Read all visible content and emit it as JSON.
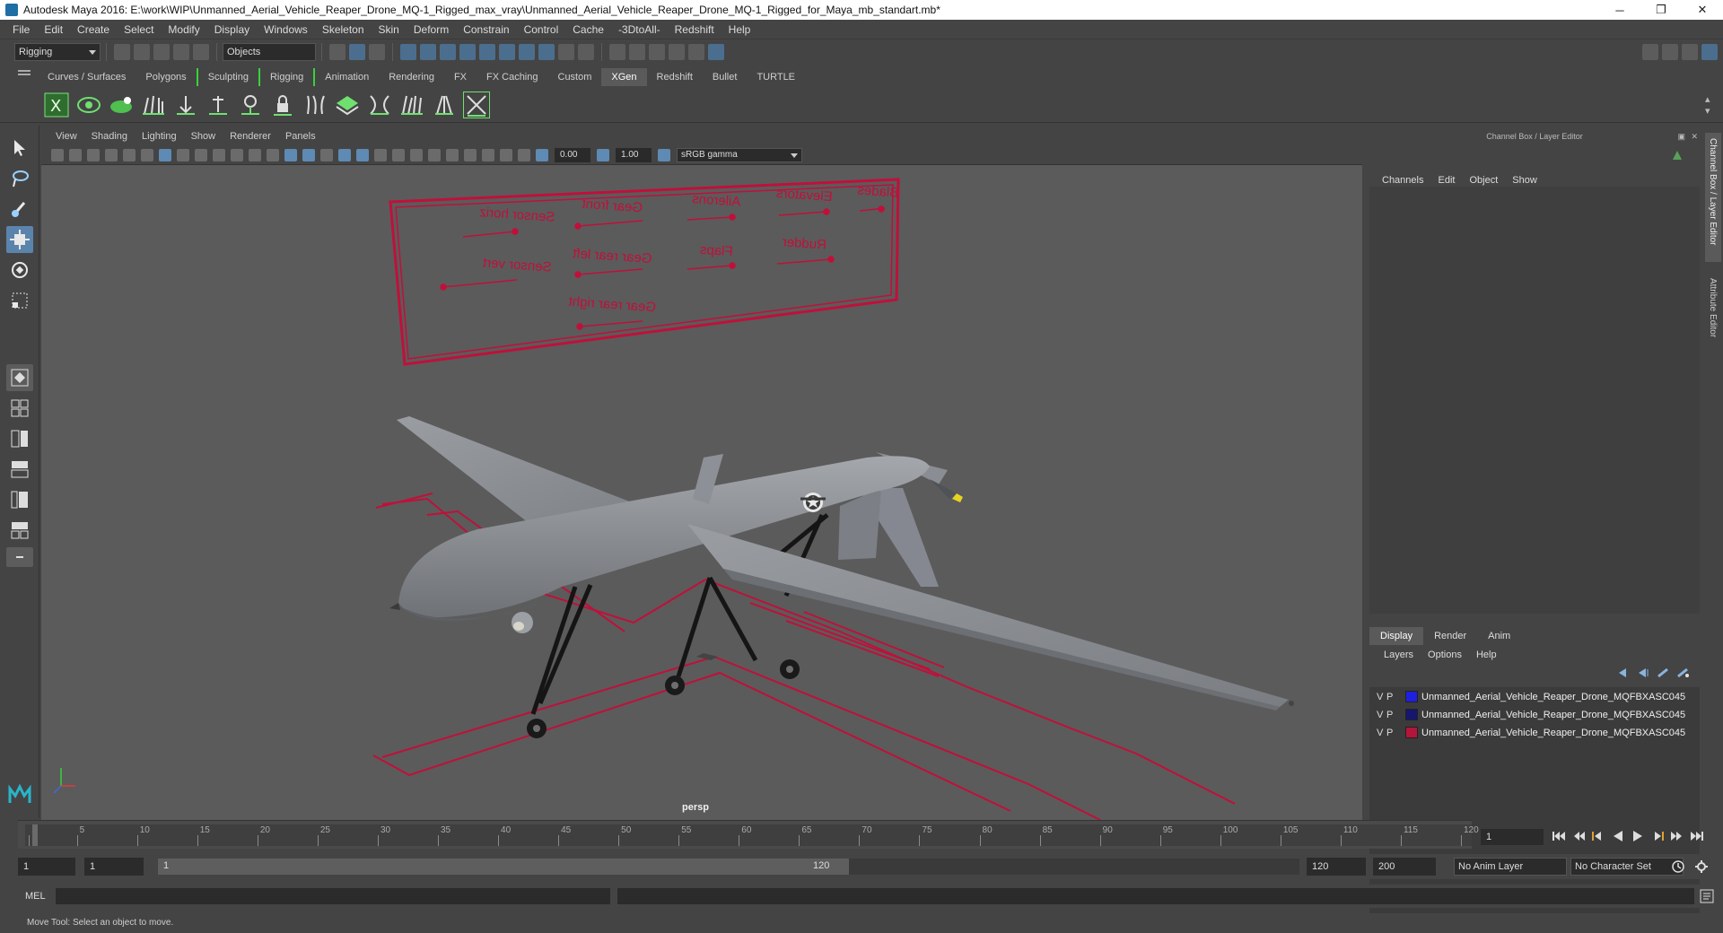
{
  "titlebar": {
    "title": "Autodesk Maya 2016: E:\\work\\WIP\\Unmanned_Aerial_Vehicle_Reaper_Drone_MQ-1_Rigged_max_vray\\Unmanned_Aerial_Vehicle_Reaper_Drone_MQ-1_Rigged_for_Maya_mb_standart.mb*",
    "minimize": "─",
    "maximize": "❐",
    "close": "✕"
  },
  "menubar": [
    "File",
    "Edit",
    "Create",
    "Select",
    "Modify",
    "Display",
    "Windows",
    "Skeleton",
    "Skin",
    "Deform",
    "Constrain",
    "Control",
    "Cache",
    "-3DtoAll-",
    "Redshift",
    "Help"
  ],
  "statusline": {
    "menuset": "Rigging",
    "selection_mode": "Objects"
  },
  "shelf_tabs": [
    "Curves / Surfaces",
    "Polygons",
    "Sculpting",
    "Rigging",
    "Animation",
    "Rendering",
    "FX",
    "FX Caching",
    "Custom",
    "XGen",
    "Redshift",
    "Bullet",
    "TURTLE"
  ],
  "shelf_active_tab": "XGen",
  "viewport": {
    "menu": [
      "View",
      "Shading",
      "Lighting",
      "Show",
      "Renderer",
      "Panels"
    ],
    "exposure": "0.00",
    "gamma": "1.00",
    "color_space": "sRGB gamma",
    "camera": "persp",
    "control_labels": [
      "Sensor horiz",
      "Gear front",
      "Ailerons",
      "Elevators",
      "Blades",
      "Sensor vert",
      "Gear rear left",
      "Flaps",
      "Rudder",
      "Gear rear right"
    ]
  },
  "channel_box": {
    "header": "Channel Box / Layer Editor",
    "menu": [
      "Channels",
      "Edit",
      "Object",
      "Show"
    ]
  },
  "layer_editor": {
    "tabs": [
      "Display",
      "Render",
      "Anim"
    ],
    "active_tab": "Display",
    "menu": [
      "Layers",
      "Options",
      "Help"
    ],
    "layers": [
      {
        "v": "V",
        "p": "P",
        "color": "#1f1fe0",
        "name": "Unmanned_Aerial_Vehicle_Reaper_Drone_MQFBXASC045"
      },
      {
        "v": "V",
        "p": "P",
        "color": "#16166e",
        "name": "Unmanned_Aerial_Vehicle_Reaper_Drone_MQFBXASC045"
      },
      {
        "v": "V",
        "p": "P",
        "color": "#b3163a",
        "name": "Unmanned_Aerial_Vehicle_Reaper_Drone_MQFBXASC045"
      }
    ]
  },
  "side_tabs": [
    "Channel Box / Layer Editor",
    "Attribute Editor"
  ],
  "timeline": {
    "ticks": [
      "1",
      "5",
      "10",
      "15",
      "20",
      "25",
      "30",
      "35",
      "40",
      "45",
      "50",
      "55",
      "60",
      "65",
      "70",
      "75",
      "80",
      "85",
      "90",
      "95",
      "100",
      "105",
      "110",
      "115",
      "120"
    ],
    "current_frame": "1"
  },
  "range": {
    "start": "1",
    "playback_start": "1",
    "range_start_label": "1",
    "range_end_label": "120",
    "playback_end": "120",
    "end": "200",
    "anim_layer": "No Anim Layer",
    "character_set": "No Character Set"
  },
  "command_line": {
    "label": "MEL"
  },
  "help_line": {
    "text": "Move Tool: Select an object to move."
  },
  "colors": {
    "accent": "#5b84ad",
    "rig_controls": "#c0103a",
    "drone": "#8e9196"
  }
}
